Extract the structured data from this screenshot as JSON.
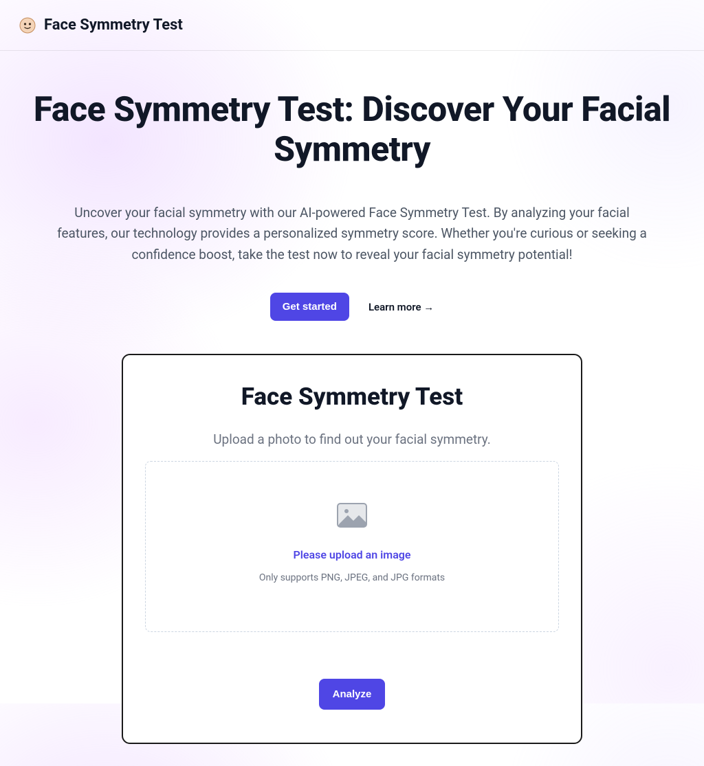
{
  "header": {
    "title": "Face Symmetry Test"
  },
  "hero": {
    "heading": "Face Symmetry Test: Discover Your Facial Symmetry",
    "description": "Uncover your facial symmetry with our AI-powered Face Symmetry Test. By analyzing your facial features, our technology provides a personalized symmetry score. Whether you're curious or seeking a confidence boost, take the test now to reveal your facial symmetry potential!",
    "cta_primary": "Get started",
    "cta_secondary": "Learn more →"
  },
  "card": {
    "title": "Face Symmetry Test",
    "subtitle": "Upload a photo to find out your facial symmetry.",
    "upload_prompt": "Please upload an image",
    "upload_hint": "Only supports PNG, JPEG, and JPG formats",
    "analyze_label": "Analyze"
  }
}
